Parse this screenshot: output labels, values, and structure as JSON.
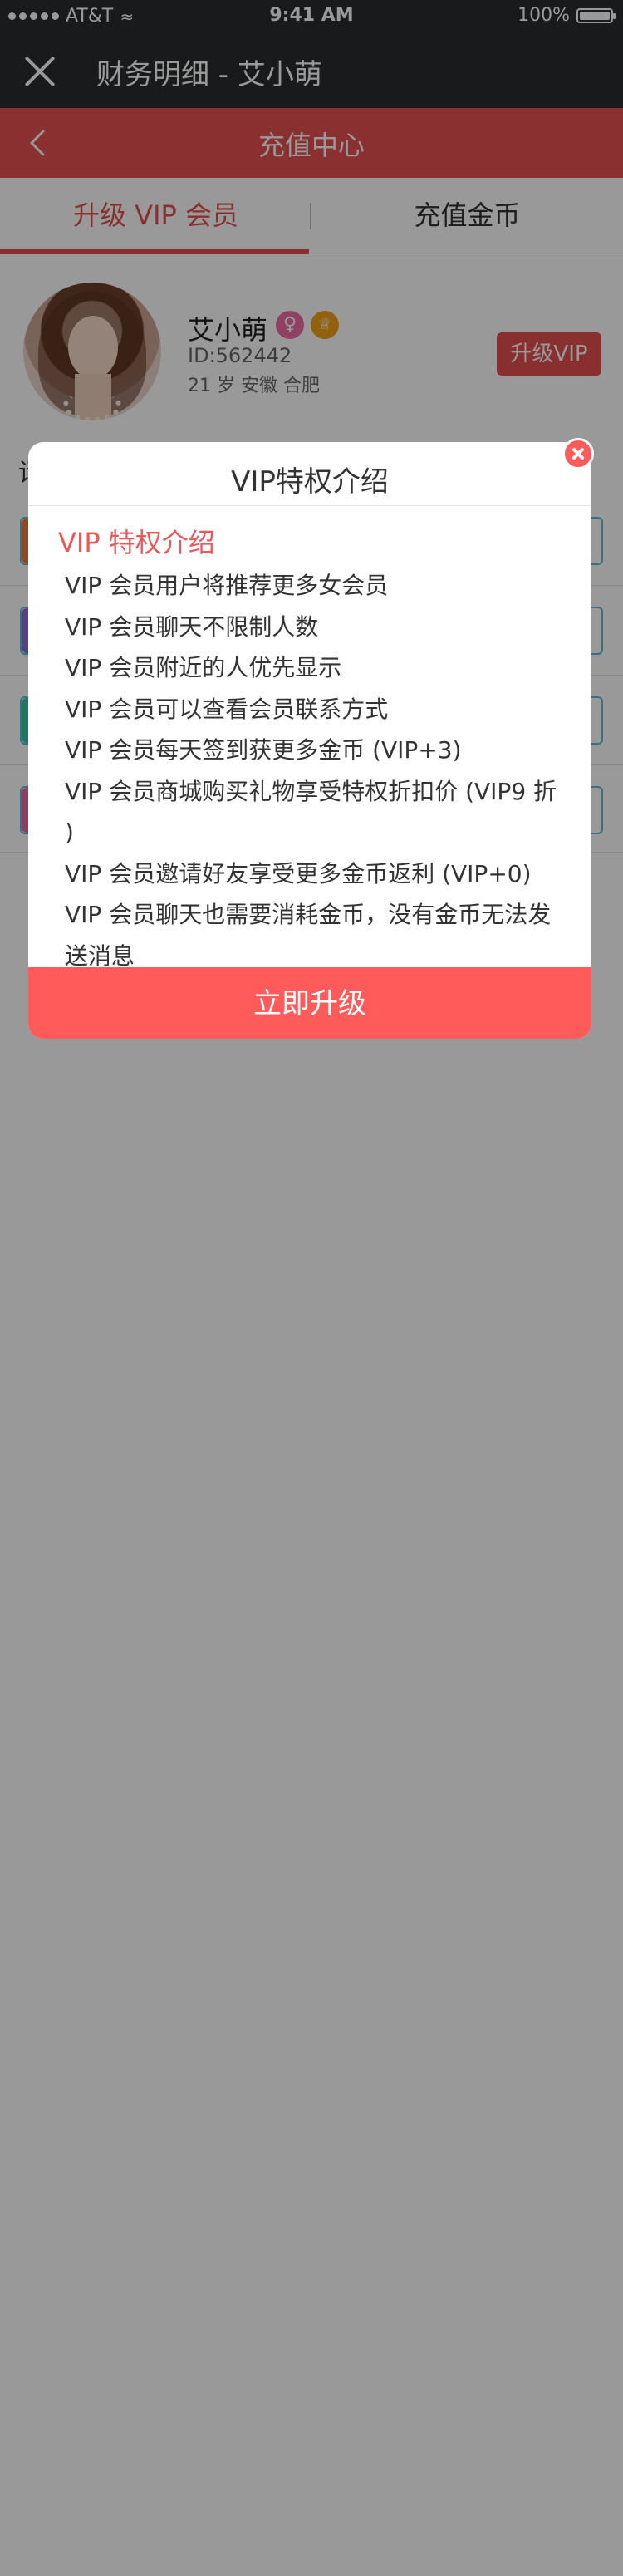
{
  "status_bar": {
    "carrier": "AT&T",
    "time": "9:41 AM",
    "battery": "100%"
  },
  "window": {
    "title": "财务明细 - 艾小萌"
  },
  "header": {
    "title": "充值中心"
  },
  "tabs": [
    {
      "label": "升级 VIP 会员",
      "active": true
    },
    {
      "label": "充值金币",
      "active": false
    }
  ],
  "profile": {
    "name": "艾小萌",
    "id": "ID:562442",
    "info": "21 岁   安徽 合肥",
    "upgrade_label": "升级VIP"
  },
  "background": {
    "section_label_fragment": "请"
  },
  "modal": {
    "title": "VIP特权介绍",
    "subtitle": "VIP 特权介绍",
    "items": [
      "VIP 会员用户将推荐更多女会员",
      "VIP 会员聊天不限制人数",
      "VIP 会员附近的人优先显示",
      "VIP 会员可以查看会员联系方式",
      "VIP 会员每天签到获更多金币 (VIP+3)",
      "VIP 会员商城购买礼物享受特权折扣价 (VIP9 折 )",
      "VIP 会员邀请好友享受更多金币返利 (VIP+0)",
      "VIP 会员聊天也需要消耗金币，没有金币无法发送消息"
    ],
    "button_label": "立即升级"
  },
  "colors": {
    "accent": "#e54f50",
    "button": "#ff5b5b",
    "dark_bar": "#2b2c2e"
  }
}
